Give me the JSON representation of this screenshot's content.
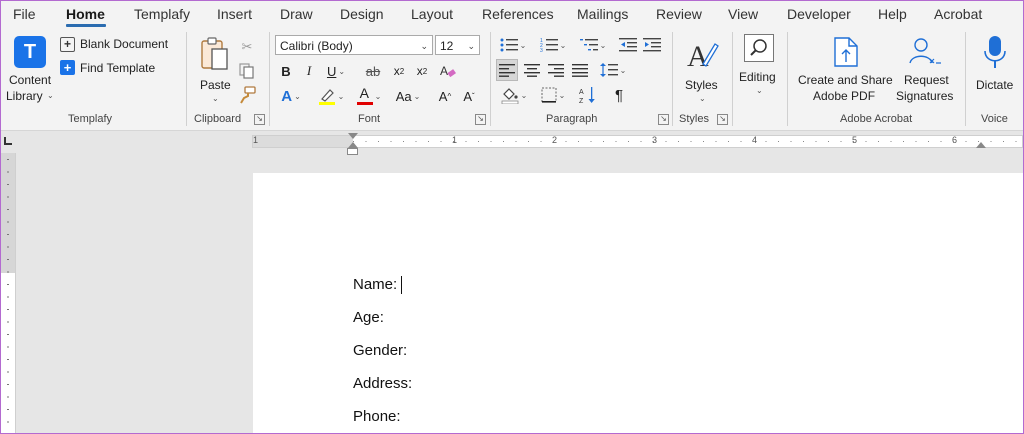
{
  "tabs": [
    "File",
    "Home",
    "Templafy",
    "Insert",
    "Draw",
    "Design",
    "Layout",
    "References",
    "Mailings",
    "Review",
    "View",
    "Developer",
    "Help",
    "Acrobat"
  ],
  "templafy": {
    "content_library_line1": "Content",
    "content_library_line2": "Library",
    "blank_document": "Blank Document",
    "find_template": "Find Template",
    "group_label": "Templafy"
  },
  "clipboard": {
    "paste": "Paste",
    "group_label": "Clipboard"
  },
  "font": {
    "name": "Calibri (Body)",
    "size": "12",
    "group_label": "Font"
  },
  "paragraph": {
    "group_label": "Paragraph"
  },
  "styles": {
    "label": "Styles",
    "group_label": "Styles"
  },
  "editing": {
    "label": "Editing"
  },
  "acrobat": {
    "create_share_line1": "Create and Share",
    "create_share_line2": "Adobe PDF",
    "request_sig_line1": "Request",
    "request_sig_line2": "Signatures",
    "group_label": "Adobe Acrobat"
  },
  "voice": {
    "dictate": "Dictate",
    "group_label": "Voice"
  },
  "ruler": {
    "numbers": [
      "1",
      "1",
      "2",
      "3",
      "4",
      "5",
      "6"
    ]
  },
  "document": {
    "lines": [
      "Name:",
      "Age:",
      "Gender:",
      "Address:",
      "Phone:"
    ]
  },
  "colors": {
    "accent": "#2b6cb0",
    "templafy_blue": "#1a73e8",
    "highlight": "#ffff00",
    "font_color": "#e00000"
  }
}
